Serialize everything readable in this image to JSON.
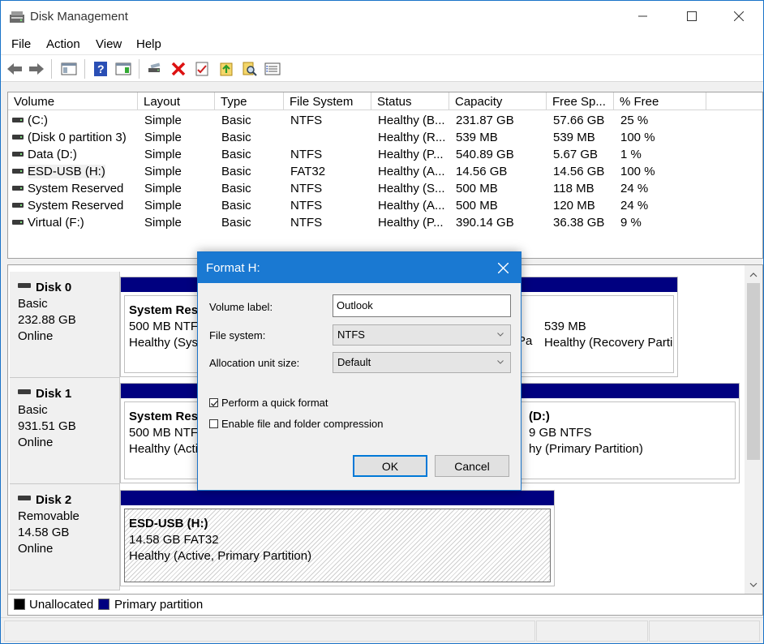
{
  "window": {
    "title": "Disk Management"
  },
  "menu": [
    "File",
    "Action",
    "View",
    "Help"
  ],
  "toolbar": {
    "icons": [
      "back-icon",
      "forward-icon",
      "console-tree-icon",
      "help-icon",
      "action-pane-icon",
      "connect-icon",
      "delete-icon",
      "properties-icon",
      "import-icon",
      "search-icon",
      "disk-list-icon"
    ]
  },
  "volume_list": {
    "columns": [
      "Volume",
      "Layout",
      "Type",
      "File System",
      "Status",
      "Capacity",
      "Free Sp...",
      "% Free"
    ],
    "rows": [
      [
        "(C:)",
        "Simple",
        "Basic",
        "NTFS",
        "Healthy (B...",
        "231.87 GB",
        "57.66 GB",
        "25 %"
      ],
      [
        "(Disk 0 partition 3)",
        "Simple",
        "Basic",
        "",
        "Healthy (R...",
        "539 MB",
        "539 MB",
        "100 %"
      ],
      [
        "Data (D:)",
        "Simple",
        "Basic",
        "NTFS",
        "Healthy (P...",
        "540.89 GB",
        "5.67 GB",
        "1 %"
      ],
      [
        "ESD-USB (H:)",
        "Simple",
        "Basic",
        "FAT32",
        "Healthy (A...",
        "14.56 GB",
        "14.56 GB",
        "100 %"
      ],
      [
        "System Reserved",
        "Simple",
        "Basic",
        "NTFS",
        "Healthy (S...",
        "500 MB",
        "118 MB",
        "24 %"
      ],
      [
        "System Reserved",
        "Simple",
        "Basic",
        "NTFS",
        "Healthy (A...",
        "500 MB",
        "120 MB",
        "24 %"
      ],
      [
        "Virtual (F:)",
        "Simple",
        "Basic",
        "NTFS",
        "Healthy (P...",
        "390.14 GB",
        "36.38 GB",
        "9 %"
      ]
    ]
  },
  "disks": {
    "disk0": {
      "name": "Disk 0",
      "type": "Basic",
      "size": "232.88 GB",
      "state": "Online",
      "p1": {
        "name": "System Rese",
        "l2": "500 MB NTFS",
        "l3": "Healthy (Syst"
      },
      "p2": {
        "l1": "",
        "l2": "539 MB",
        "l3": "Healthy (Recovery Parti",
        "frag": "Pa"
      }
    },
    "disk1": {
      "name": "Disk 1",
      "type": "Basic",
      "size": "931.51 GB",
      "state": "Online",
      "p1": {
        "name": "System Rese",
        "l2": "500 MB NTFS",
        "l3": "Healthy (Activ"
      },
      "p2": {
        "name": "(D:)",
        "l2": "9 GB NTFS",
        "l3": "hy (Primary Partition)"
      }
    },
    "disk2": {
      "name": "Disk 2",
      "type": "Removable",
      "size": "14.58 GB",
      "state": "Online",
      "p1": {
        "name": "ESD-USB  (H:)",
        "l2": "14.58 GB FAT32",
        "l3": "Healthy (Active, Primary Partition)"
      }
    }
  },
  "legend": {
    "unallocated": "Unallocated",
    "primary": "Primary partition",
    "unallocated_color": "#000000",
    "primary_color": "#000080"
  },
  "dialog": {
    "title": "Format H:",
    "volume_label_text": "Volume label:",
    "volume_label_value": "Outlook",
    "file_system_text": "File system:",
    "file_system_value": "NTFS",
    "alloc_text": "Allocation unit size:",
    "alloc_value": "Default",
    "quick_format_text": "Perform a quick format",
    "quick_format_checked": true,
    "compression_text": "Enable file and folder compression",
    "compression_checked": false,
    "ok_label": "OK",
    "cancel_label": "Cancel"
  }
}
